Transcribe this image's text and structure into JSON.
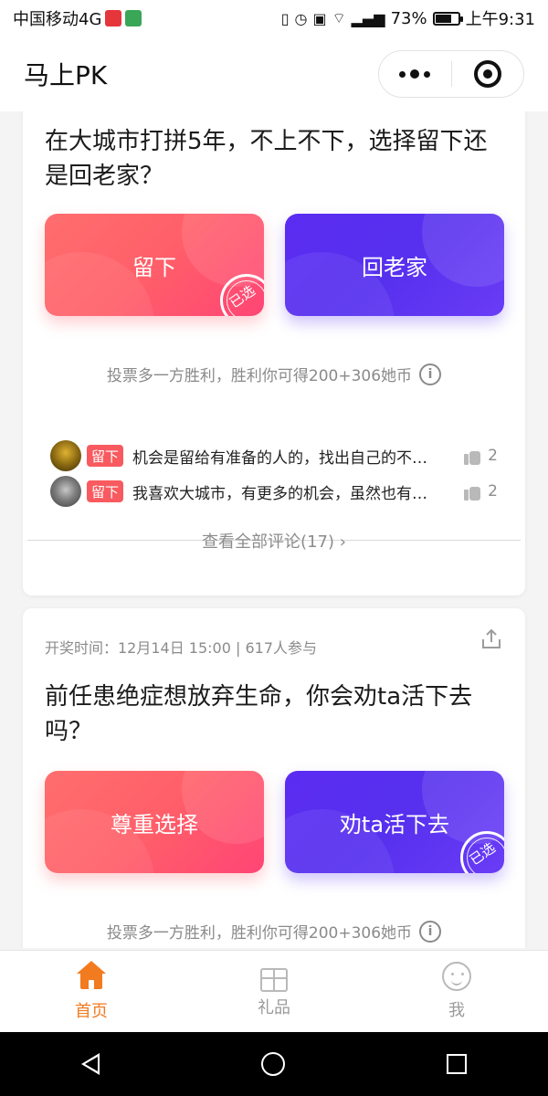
{
  "status_bar": {
    "carrier": "中国移动4G",
    "battery_percent": "73%",
    "time": "上午9:31",
    "battery_level": 0.73,
    "icons": [
      "notification-app-icon",
      "wechat-app-icon",
      "vibrate-icon",
      "alarm-icon",
      "hd-icon",
      "wifi-icon",
      "signal-icon",
      "battery-icon"
    ]
  },
  "header": {
    "title": "马上PK"
  },
  "cards": [
    {
      "question": "在大城市打拼5年，不上不下，选择留下还是回老家？",
      "options": [
        "留下",
        "回老家"
      ],
      "selected_option": "留下",
      "stamp_text": "已选",
      "reward_text": "投票多一方胜利，胜利你可得200+306她币",
      "comments": [
        {
          "tag": "留下",
          "text": "机会是留给有准备的人的，找出自己的不…",
          "likes": "2"
        },
        {
          "tag": "留下",
          "text": "我喜欢大城市，有更多的机会，虽然也有…",
          "likes": "2"
        }
      ],
      "view_all": "查看全部评论(17)"
    },
    {
      "meta": "开奖时间：12月14日 15:00 | 617人参与",
      "question": "前任患绝症想放弃生命，你会劝ta活下去吗？",
      "options": [
        "尊重选择",
        "劝ta活下去"
      ],
      "selected_option": "劝ta活下去",
      "stamp_text": "已选",
      "reward_text": "投票多一方胜利，胜利你可得200+306她币"
    }
  ],
  "tabs": [
    {
      "label": "首页",
      "active": true
    },
    {
      "label": "礼品",
      "active": false
    },
    {
      "label": "我",
      "active": false
    }
  ],
  "colors": {
    "accent_orange": "#f27b1f",
    "vote_red": "#ff5f69",
    "vote_blue": "#5630ee",
    "tag_red": "#f85a5f"
  }
}
